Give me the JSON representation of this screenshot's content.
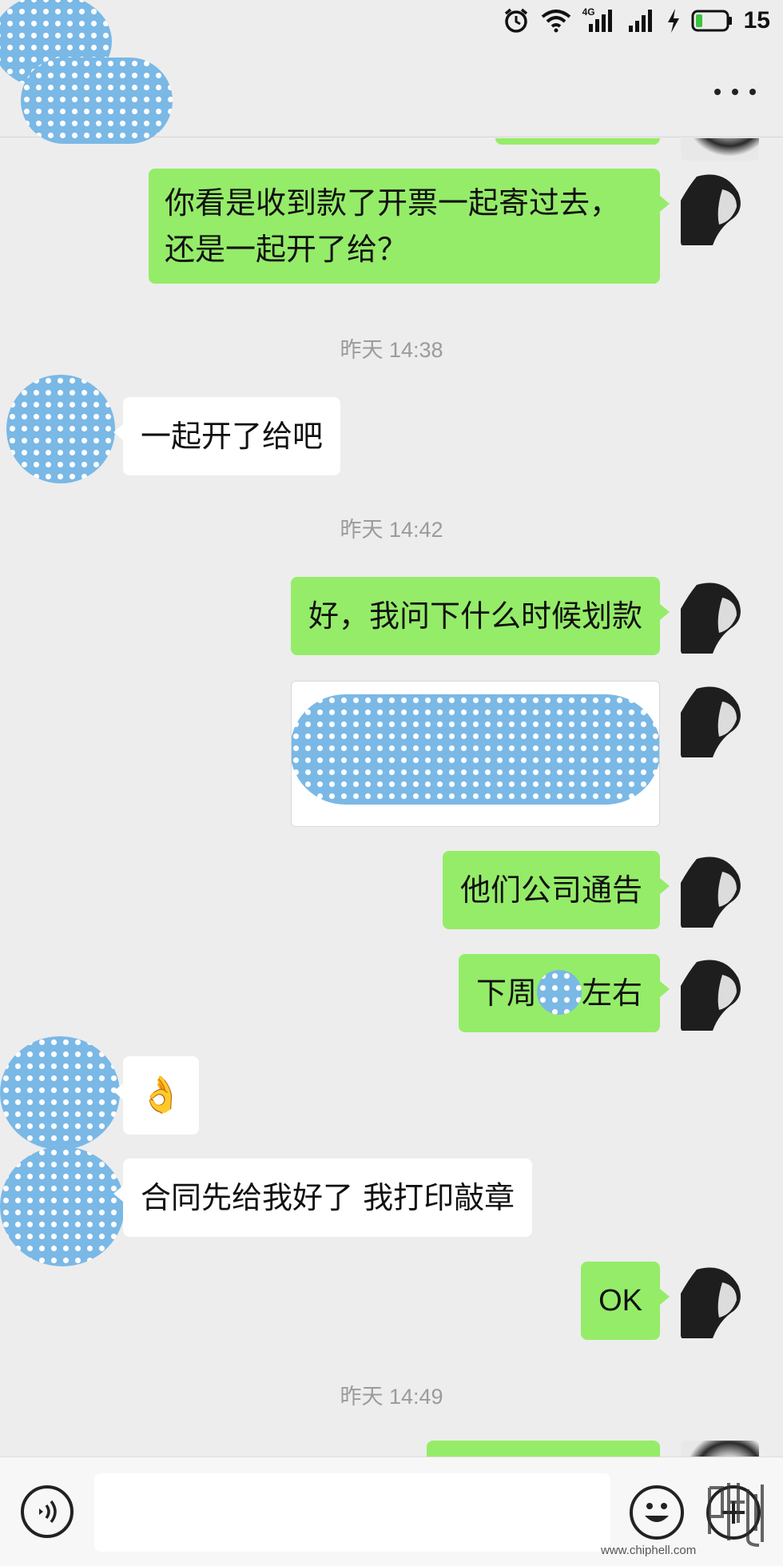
{
  "status_bar": {
    "battery": "15",
    "network": "4G"
  },
  "messages": [
    {
      "id": "m1",
      "side": "out",
      "lines": [
        "你看是收到款了开票一起寄过去，",
        "还是一起开了给？"
      ]
    },
    {
      "id": "t1",
      "type": "time",
      "text": "昨天 14:38"
    },
    {
      "id": "m2",
      "side": "in",
      "text": "一起开了给吧"
    },
    {
      "id": "t2",
      "type": "time",
      "text": "昨天 14:42"
    },
    {
      "id": "m3",
      "side": "out",
      "text": "好，我问下什么时候划款"
    },
    {
      "id": "m4",
      "side": "out",
      "type": "image",
      "note": "redacted"
    },
    {
      "id": "m5",
      "side": "out",
      "text": "他们公司通告"
    },
    {
      "id": "m6",
      "side": "out",
      "text_before": "下周",
      "text_after": "左右"
    },
    {
      "id": "m7",
      "side": "in",
      "emoji": "👌"
    },
    {
      "id": "m8",
      "side": "in",
      "text": "合同先给我好了 我打印敲章"
    },
    {
      "id": "m9",
      "side": "out",
      "text": "OK"
    },
    {
      "id": "t3",
      "type": "time",
      "text": "昨天 14:49"
    }
  ],
  "input_bar": {
    "placeholder": "",
    "watermark": "www.chiphell.com"
  },
  "colors": {
    "background": "#ededed",
    "outgoing_bubble": "#95ec69",
    "incoming_bubble": "#ffffff",
    "redaction": "#7ab8e6"
  },
  "icons": {
    "alarm": "alarm-clock-icon",
    "wifi": "wifi-icon",
    "signal": "signal-bars-icon",
    "charging": "lightning-icon",
    "battery": "battery-icon",
    "more": "more-dots-icon",
    "voice": "voice-icon",
    "emoji": "smiley-icon",
    "plus": "plus-icon"
  }
}
